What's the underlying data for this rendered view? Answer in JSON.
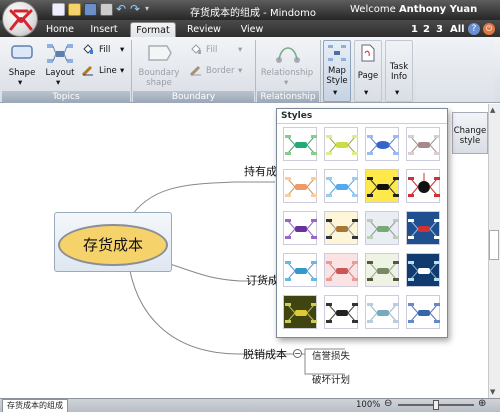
{
  "window": {
    "title": "存货成本的组成 - Mindomo",
    "welcome_prefix": "Welcome",
    "user_name": "Anthony Yuan"
  },
  "tabs": [
    {
      "label": "Home",
      "active": false
    },
    {
      "label": "Insert",
      "active": false
    },
    {
      "label": "Format",
      "active": true
    },
    {
      "label": "Review",
      "active": false
    },
    {
      "label": "View",
      "active": false
    }
  ],
  "pages": [
    "1",
    "2",
    "3",
    "All"
  ],
  "ribbon": {
    "topics": {
      "label": "Topics",
      "shape": "Shape",
      "layout": "Layout",
      "fill": "Fill",
      "line": "Line"
    },
    "boundary": {
      "label": "Boundary",
      "boundary_shape": "Boundary shape",
      "fill": "Fill",
      "border": "Border"
    },
    "relationship": {
      "label": "Relationship",
      "relationship": "Relationship"
    },
    "map_style": "Map Style",
    "page": "Page",
    "task_info": "Task Info",
    "change_style": "Change style"
  },
  "popup": {
    "title": "Styles"
  },
  "mindmap": {
    "central": "存货成本",
    "branches": [
      "持有成本",
      "订货成本",
      "脱销成本"
    ],
    "subitems": [
      "信誉损失",
      "破坏计划"
    ]
  },
  "status": {
    "doc_tab": "存货成本的组成",
    "zoom": "100%"
  },
  "colors": {
    "accent_yellow": "#f6d36a",
    "ribbon_label": "#9aa7b6",
    "titlebar": "#3a3a3a"
  }
}
